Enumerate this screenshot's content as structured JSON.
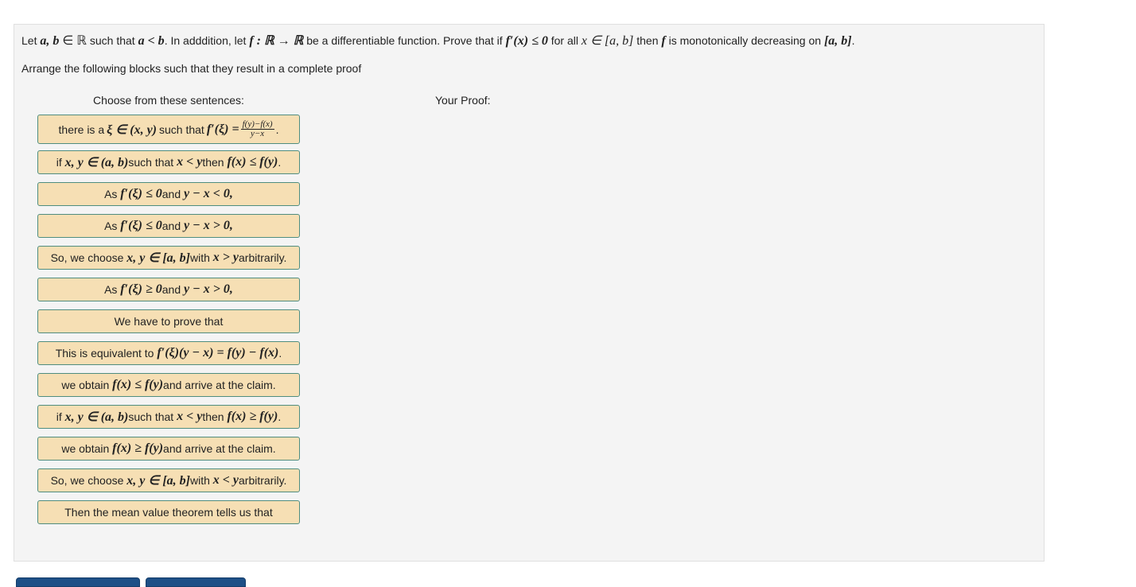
{
  "question": {
    "text_parts": [
      "Let ",
      "a, b",
      " ∈ ℝ",
      " such that ",
      "a < b",
      ". In adddition, let ",
      "f : ℝ → ℝ",
      " be a differentiable function. Prove that if ",
      "f′(x) ≤ 0",
      " for all ",
      "x ∈ [a, b]",
      " then ",
      "f",
      " is monotonically decreasing on ",
      "[a, b]",
      "."
    ]
  },
  "instruction": "Arrange the following blocks such that they result in a complete proof",
  "left_header": "Choose from these sentences:",
  "right_header": "Your Proof:",
  "blocks": [
    {
      "text": "there is a ξ ∈ (x, y) such that f′(ξ) = (f(y)−f(x))/(y−x).",
      "parts": [
        "there is a ",
        "ξ ∈ (x, y)",
        " such that ",
        "f′(ξ) = "
      ],
      "frac_num": "f(y)−f(x)",
      "frac_den": "y−x",
      "end": "."
    },
    {
      "text": "if x, y ∈ (a, b) such that x < y then f(x) ≤ f(y).",
      "parts": [
        "if ",
        "x, y ∈ (a, b)",
        " such that ",
        "x < y",
        " then ",
        "f(x) ≤ f(y)",
        "."
      ]
    },
    {
      "text": "As f′(ξ) ≤ 0 and y − x < 0,",
      "parts": [
        "As ",
        "f′(ξ) ≤ 0",
        " and ",
        "y − x < 0,"
      ]
    },
    {
      "text": "As f′(ξ) ≤ 0 and y − x > 0,",
      "parts": [
        "As ",
        "f′(ξ) ≤ 0",
        " and ",
        "y − x > 0,"
      ]
    },
    {
      "text": "So, we choose x, y ∈ [a, b] with x > y arbitrarily.",
      "parts": [
        "So, we choose ",
        "x, y ∈ [a, b]",
        " with ",
        "x > y",
        " arbitrarily."
      ]
    },
    {
      "text": "As f′(ξ) ≥ 0 and y − x > 0,",
      "parts": [
        "As ",
        "f′(ξ) ≥ 0",
        " and ",
        "y − x > 0,"
      ]
    },
    {
      "text": "We have to prove that",
      "parts": [
        "We have to prove that"
      ]
    },
    {
      "text": "This is equivalent to f′(ξ)(y − x) = f(y) − f(x).",
      "parts": [
        "This is equivalent to ",
        "f′(ξ)(y − x) = f(y) − f(x)",
        "."
      ]
    },
    {
      "text": "we obtain f(x) ≤ f(y) and arrive at the claim.",
      "parts": [
        "we obtain ",
        "f(x) ≤ f(y)",
        " and arrive at the claim."
      ]
    },
    {
      "text": "if x, y ∈ (a, b) such that x < y then f(x) ≥ f(y).",
      "parts": [
        "if ",
        "x, y ∈ (a, b)",
        " such that ",
        "x < y",
        " then ",
        "f(x) ≥ f(y)",
        "."
      ]
    },
    {
      "text": "we obtain f(x) ≥ f(y) and arrive at the claim.",
      "parts": [
        "we obtain ",
        "f(x) ≥ f(y)",
        " and arrive at the claim."
      ]
    },
    {
      "text": "So, we choose x, y ∈ [a, b] with x < y arbitrarily.",
      "parts": [
        "So, we choose ",
        "x, y ∈ [a, b]",
        " with ",
        "x < y",
        " arbitrarily."
      ]
    },
    {
      "text": "Then the mean value theorem tells us that",
      "parts": [
        "Then the mean value theorem tells us that"
      ]
    }
  ],
  "colors": {
    "block_bg": "#f6dfb4",
    "block_border": "#4f8d7f",
    "panel_bg": "#f4f4f4",
    "button": "#1d4f86"
  }
}
